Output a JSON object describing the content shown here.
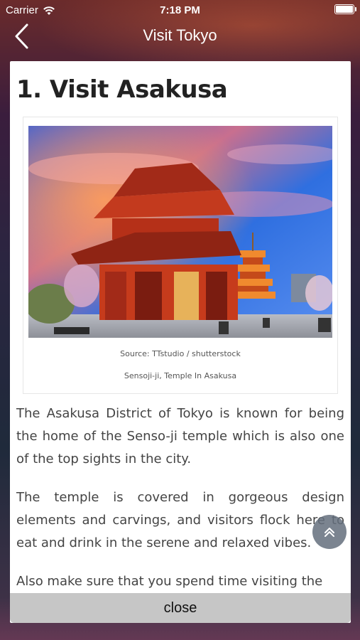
{
  "status_bar": {
    "carrier": "Carrier",
    "time": "7:18 PM"
  },
  "nav": {
    "title": "Visit Tokyo",
    "back_icon": "chevron-left-icon"
  },
  "article": {
    "heading": "1. Visit Asakusa",
    "figure": {
      "source": "Source: TTstudio / shutterstock",
      "caption": "Sensoji-ji, Temple In Asakusa"
    },
    "paragraphs": [
      "The Asakusa District of Tokyo is known for being the home of the Senso-ji temple which is also one of the top sights in the city.",
      "The temple is covered in gorgeous design elements and carvings, and visitors flock here to eat and drink in the serene and relaxed vibes.",
      "Also make sure that you spend time visiting the"
    ]
  },
  "close_label": "close",
  "scroll_top_icon": "double-chevron-up-icon"
}
